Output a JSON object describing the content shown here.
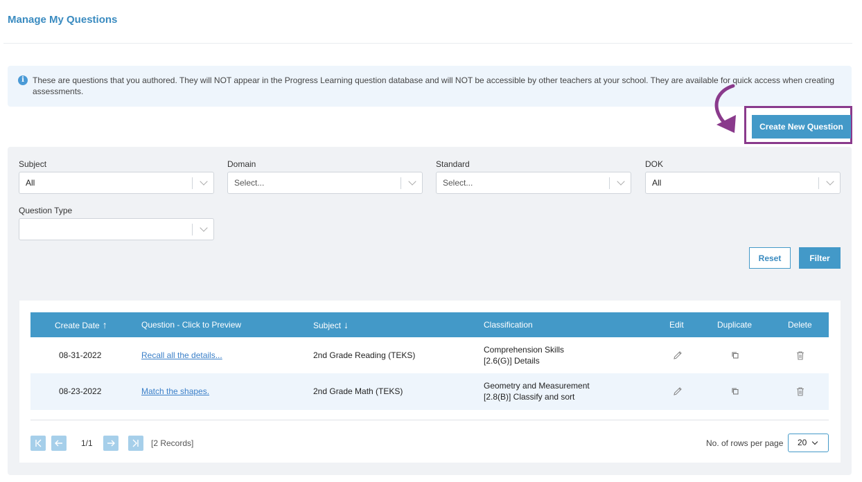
{
  "page": {
    "title": "Manage My Questions"
  },
  "info": {
    "text": "These are questions that you authored. They will NOT appear in the Progress Learning question database and will NOT be accessible by other teachers at your school. They are available for quick access when creating assessments."
  },
  "actions": {
    "create_label": "Create New Question"
  },
  "filters": {
    "subject": {
      "label": "Subject",
      "value": "All"
    },
    "domain": {
      "label": "Domain",
      "value": "Select..."
    },
    "standard": {
      "label": "Standard",
      "value": "Select..."
    },
    "dok": {
      "label": "DOK",
      "value": "All"
    },
    "question_type": {
      "label": "Question Type",
      "value": ""
    },
    "reset_label": "Reset",
    "filter_label": "Filter"
  },
  "table": {
    "headers": {
      "create_date": "Create Date",
      "question": "Question - Click to Preview",
      "subject": "Subject",
      "classification": "Classification",
      "edit": "Edit",
      "duplicate": "Duplicate",
      "delete": "Delete"
    },
    "rows": [
      {
        "date": "08-31-2022",
        "question": "Recall all the details...",
        "subject": "2nd Grade Reading (TEKS)",
        "classification_1": "Comprehension Skills",
        "classification_2": "[2.6(G)] Details"
      },
      {
        "date": "08-23-2022",
        "question": "Match the shapes.",
        "subject": "2nd Grade Math (TEKS)",
        "classification_1": "Geometry and Measurement",
        "classification_2": "[2.8(B)] Classify and sort"
      }
    ]
  },
  "pagination": {
    "page": "1/1",
    "records": "[2 Records]",
    "rows_label": "No. of rows per page",
    "rows_value": "20"
  },
  "colors": {
    "primary": "#4399c8",
    "highlight": "#8a3a8c"
  },
  "icons": {
    "info": "info-icon",
    "edit": "pencil-icon",
    "duplicate": "copy-icon",
    "delete": "trash-icon"
  }
}
